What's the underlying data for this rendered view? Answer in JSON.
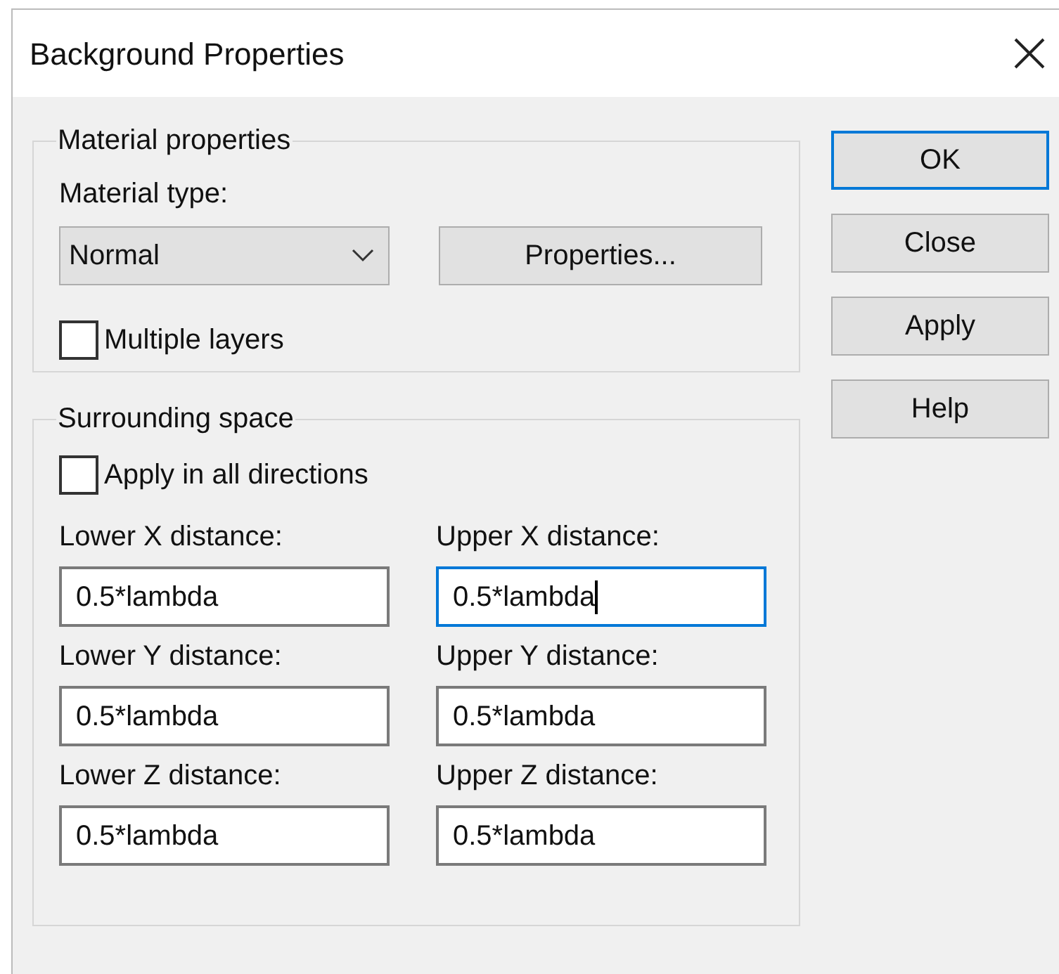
{
  "window": {
    "title": "Background Properties"
  },
  "material_properties": {
    "legend": "Material properties",
    "material_type_label": "Material type:",
    "material_type": "Normal",
    "properties_button": "Properties...",
    "multiple_layers": {
      "label": "Multiple layers",
      "checked": false
    }
  },
  "surrounding_space": {
    "legend": "Surrounding space",
    "apply_all": {
      "label": "Apply in all directions",
      "checked": false
    },
    "fields": [
      {
        "label": "Lower X distance:",
        "value": "0.5*lambda",
        "focused": false
      },
      {
        "label": "Upper X distance:",
        "value": "0.5*lambda",
        "focused": true
      },
      {
        "label": "Lower Y distance:",
        "value": "0.5*lambda",
        "focused": false
      },
      {
        "label": "Upper Y distance:",
        "value": "0.5*lambda",
        "focused": false
      },
      {
        "label": "Lower Z distance:",
        "value": "0.5*lambda",
        "focused": false
      },
      {
        "label": "Upper Z distance:",
        "value": "0.5*lambda",
        "focused": false
      }
    ]
  },
  "buttons": [
    {
      "label": "OK",
      "default": true
    },
    {
      "label": "Close",
      "default": false
    },
    {
      "label": "Apply",
      "default": false
    },
    {
      "label": "Help",
      "default": false
    }
  ]
}
